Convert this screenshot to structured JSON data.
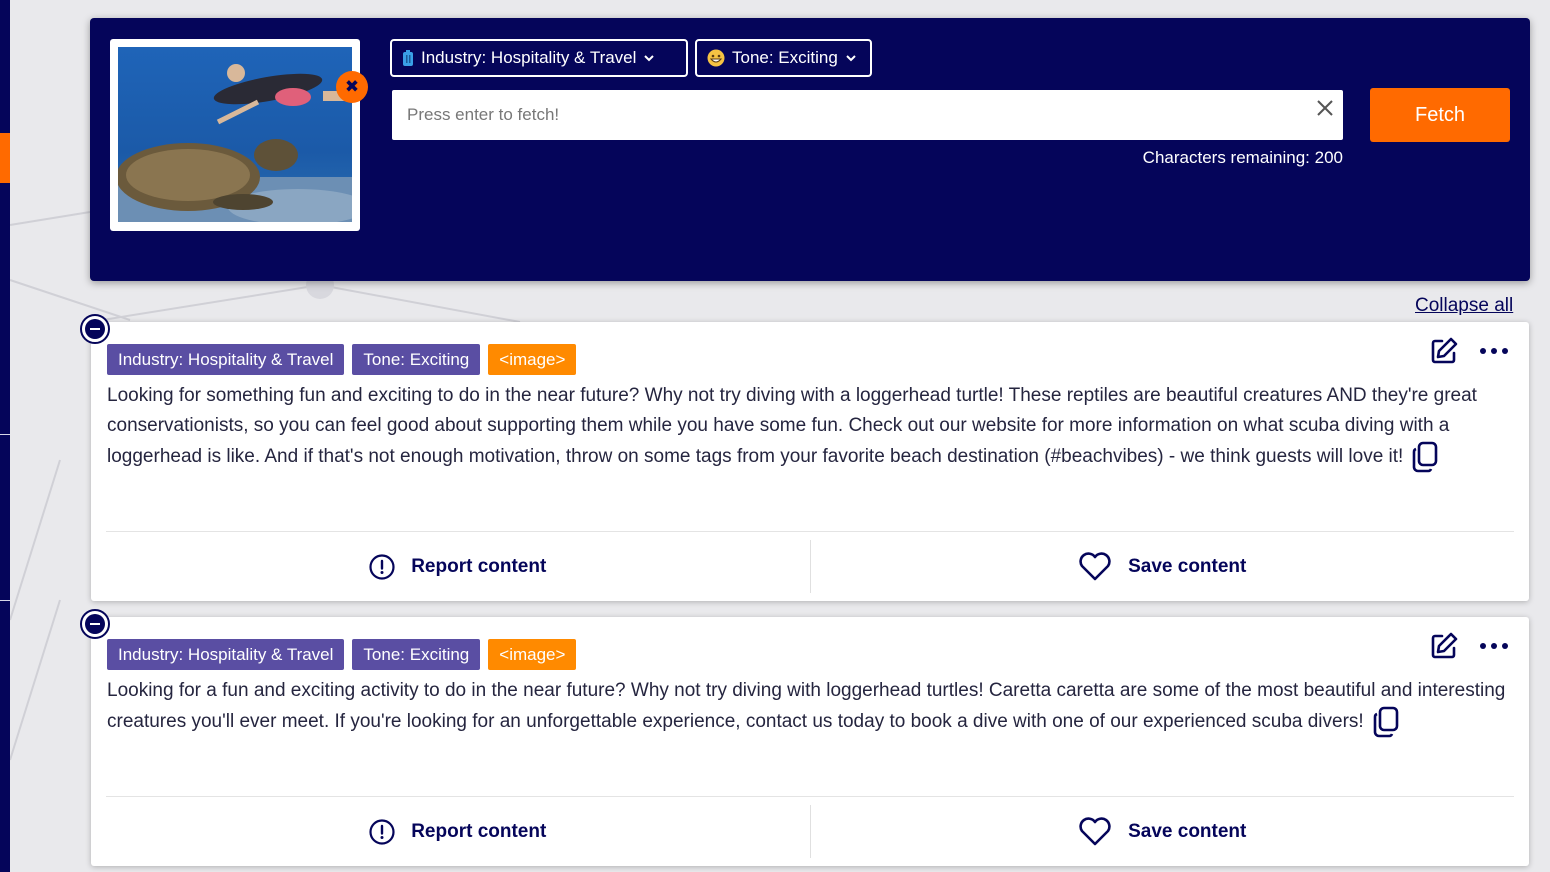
{
  "search_panel": {
    "thumbnail_alt": "Diver swimming with a sea turtle",
    "remove_image_glyph": "✖",
    "industry_dropdown": {
      "icon": "suitcase-icon",
      "label": "Industry: Hospitality & Travel"
    },
    "tone_dropdown": {
      "icon": "grinning-face-icon",
      "label": "Tone: Exciting"
    },
    "search_placeholder": "Press enter to fetch!",
    "search_value": "",
    "characters_remaining": "Characters remaining: 200",
    "fetch_label": "Fetch"
  },
  "collapse_all_label": "Collapse all",
  "results": [
    {
      "tags": [
        "Industry: Hospitality & Travel",
        "Tone: Exciting",
        "<image>"
      ],
      "text": "Looking for something fun and exciting to do in the near future? Why not try diving with a loggerhead turtle! These reptiles are beautiful creatures AND they're great conservationists, so you can feel good about supporting them while you have some fun. Check out our website for more information on what scuba diving with a loggerhead is like. And if that's not enough motivation, throw on some tags from your favorite beach destination (#beachvibes) - we think guests will love it!",
      "report_label": "Report content",
      "save_label": "Save content"
    },
    {
      "tags": [
        "Industry: Hospitality & Travel",
        "Tone: Exciting",
        "<image>"
      ],
      "text": "Looking for a fun and exciting activity to do in the near future? Why not try diving with loggerhead turtles! Caretta caretta are some of the most beautiful and interesting creatures you'll ever meet. If you're looking for an unforgettable experience, contact us today to book a dive with one of our experienced scuba divers!",
      "report_label": "Report content",
      "save_label": "Save content"
    }
  ],
  "colors": {
    "navy": "#05055a",
    "orange": "#ff6a00",
    "tag_purple": "#5a4ea3",
    "tag_orange": "#ff8a00"
  }
}
